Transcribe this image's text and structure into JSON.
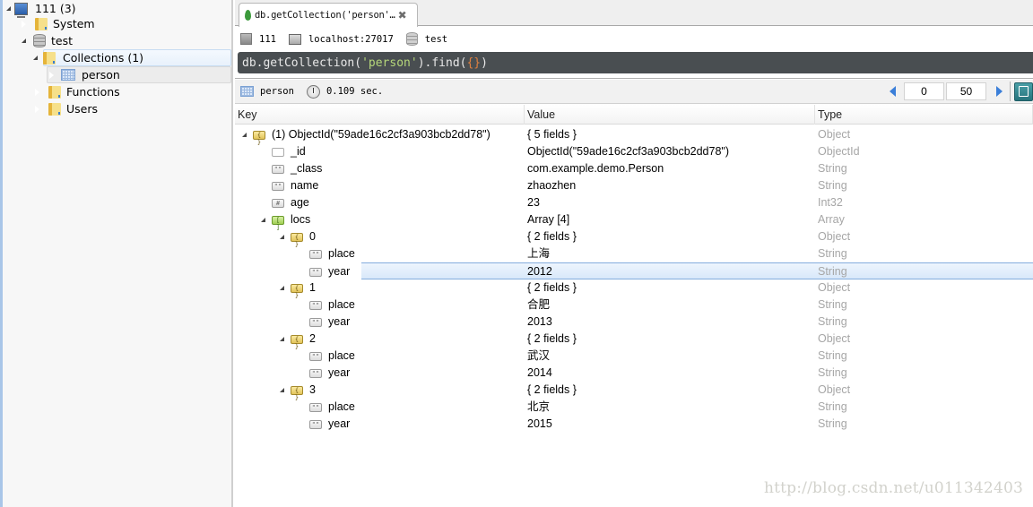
{
  "explorer": {
    "server": {
      "label": "111 (3)",
      "icon": "computer-icon"
    },
    "system": {
      "label": "System",
      "icon": "folder-icon"
    },
    "database": {
      "label": "test",
      "icon": "database-icon"
    },
    "collections": {
      "label": "Collections (1)",
      "icon": "folder-icon"
    },
    "collection_person": {
      "label": "person",
      "icon": "table-grid-icon"
    },
    "functions": {
      "label": "Functions",
      "icon": "folder-icon"
    },
    "users": {
      "label": "Users",
      "icon": "folder-icon"
    }
  },
  "tab": {
    "label": "db.getCollection('person'…",
    "icon": "mongodb-leaf-icon",
    "close": "✖"
  },
  "connection": {
    "server": "111",
    "host": "localhost:27017",
    "database": "test"
  },
  "query": {
    "prefix": "db.getCollection(",
    "arg": "'person'",
    "mid": ").find(",
    "braces": "{}",
    "suffix": ")"
  },
  "result": {
    "collection": "person",
    "time": "0.109 sec.",
    "page_start": "0",
    "page_size": "50"
  },
  "table": {
    "columns": {
      "key": "Key",
      "value": "Value",
      "type": "Type"
    },
    "rows": [
      {
        "key": "(1) ObjectId(\"59ade16c2cf3a903bcb2dd78\")",
        "value": "{ 5 fields }",
        "type": "Object",
        "icon": "obj",
        "glyph": "{ }",
        "level": 0,
        "expand": true
      },
      {
        "key": "_id",
        "value": "ObjectId(\"59ade16c2cf3a903bcb2dd78\")",
        "type": "ObjectId",
        "icon": "id",
        "glyph": "",
        "level": 1,
        "expand": false
      },
      {
        "key": "_class",
        "value": "com.example.demo.Person",
        "type": "String",
        "icon": "str",
        "glyph": "\"\"",
        "level": 1,
        "expand": false
      },
      {
        "key": "name",
        "value": "zhaozhen",
        "type": "String",
        "icon": "str",
        "glyph": "\"\"",
        "level": 1,
        "expand": false
      },
      {
        "key": "age",
        "value": "23",
        "type": "Int32",
        "icon": "num",
        "glyph": "#",
        "level": 1,
        "expand": false
      },
      {
        "key": "locs",
        "value": "Array [4]",
        "type": "Array",
        "icon": "arr",
        "glyph": "[ ]",
        "level": 1,
        "expand": true
      },
      {
        "key": "0",
        "value": "{ 2 fields }",
        "type": "Object",
        "icon": "obj",
        "glyph": "{ }",
        "level": 2,
        "expand": true
      },
      {
        "key": "place",
        "value": "上海",
        "type": "String",
        "icon": "str",
        "glyph": "\"\"",
        "level": 3,
        "expand": false
      },
      {
        "key": "year",
        "value": "2012",
        "type": "String",
        "icon": "str",
        "glyph": "\"\"",
        "level": 3,
        "expand": false,
        "selected": true
      },
      {
        "key": "1",
        "value": "{ 2 fields }",
        "type": "Object",
        "icon": "obj",
        "glyph": "{ }",
        "level": 2,
        "expand": true
      },
      {
        "key": "place",
        "value": "合肥",
        "type": "String",
        "icon": "str",
        "glyph": "\"\"",
        "level": 3,
        "expand": false
      },
      {
        "key": "year",
        "value": "2013",
        "type": "String",
        "icon": "str",
        "glyph": "\"\"",
        "level": 3,
        "expand": false
      },
      {
        "key": "2",
        "value": "{ 2 fields }",
        "type": "Object",
        "icon": "obj",
        "glyph": "{ }",
        "level": 2,
        "expand": true
      },
      {
        "key": "place",
        "value": "武汉",
        "type": "String",
        "icon": "str",
        "glyph": "\"\"",
        "level": 3,
        "expand": false
      },
      {
        "key": "year",
        "value": "2014",
        "type": "String",
        "icon": "str",
        "glyph": "\"\"",
        "level": 3,
        "expand": false
      },
      {
        "key": "3",
        "value": "{ 2 fields }",
        "type": "Object",
        "icon": "obj",
        "glyph": "{ }",
        "level": 2,
        "expand": true
      },
      {
        "key": "place",
        "value": "北京",
        "type": "String",
        "icon": "str",
        "glyph": "\"\"",
        "level": 3,
        "expand": false
      },
      {
        "key": "year",
        "value": "2015",
        "type": "String",
        "icon": "str",
        "glyph": "\"\"",
        "level": 3,
        "expand": false
      }
    ]
  },
  "watermark": "http://blog.csdn.net/u011342403"
}
